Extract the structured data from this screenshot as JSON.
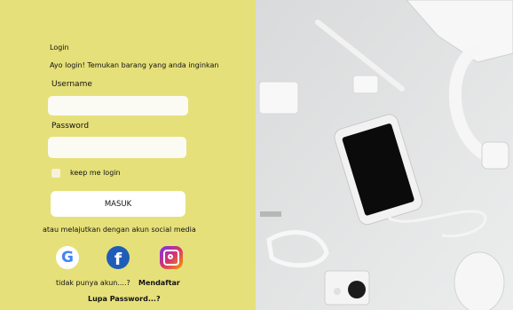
{
  "login": {
    "heading": "Login",
    "subheading": "Ayo login! Temukan barang yang anda inginkan",
    "username_label": "Username",
    "username_value": "",
    "password_label": "Password",
    "password_value": "",
    "remember_label": "keep me login",
    "submit_label": "MASUK",
    "social_caption": "atau melajutkan dengan akun social media",
    "no_account_text": "tidak punya akun....?",
    "register_link": "Mendaftar",
    "forgot_link": "Lupa Password...?"
  },
  "social": {
    "google_letter": "G",
    "facebook_letter": "f"
  },
  "colors": {
    "panel": "#e6e07a",
    "google": "#ffffff",
    "facebook": "#1f5db8",
    "instagram": "#d6336c"
  },
  "icons": [
    "google-icon",
    "facebook-icon",
    "instagram-icon"
  ]
}
